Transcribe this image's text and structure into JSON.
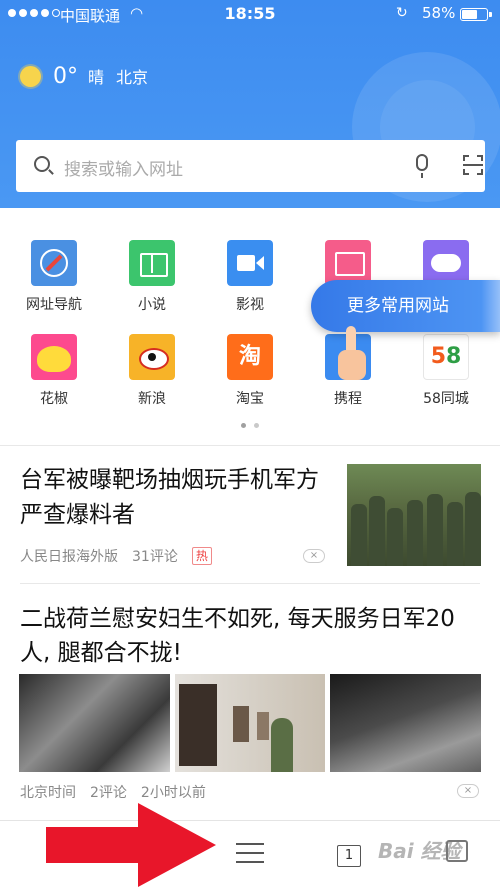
{
  "status_bar": {
    "carrier": "中国联通",
    "time": "18:55",
    "battery": "58%",
    "battery_level": 0.58
  },
  "weather": {
    "temperature": "0°",
    "condition": "晴",
    "city": "北京"
  },
  "search": {
    "placeholder": "搜索或输入网址"
  },
  "quick_links": [
    {
      "label": "网址导航",
      "icon": "compass-icon"
    },
    {
      "label": "小说",
      "icon": "book-icon"
    },
    {
      "label": "影视",
      "icon": "video-camera-icon"
    },
    {
      "label": "",
      "icon": "picture-icon"
    },
    {
      "label": "",
      "icon": "gamepad-icon"
    },
    {
      "label": "花椒",
      "icon": "huajiao-icon"
    },
    {
      "label": "新浪",
      "icon": "sina-weibo-icon"
    },
    {
      "label": "淘宝",
      "icon": "taobao-icon",
      "glyph": "淘"
    },
    {
      "label": "携程",
      "icon": "ctrip-icon"
    },
    {
      "label": "58同城",
      "icon": "58-icon",
      "glyph_a": "5",
      "glyph_b": "8"
    }
  ],
  "tooltip": "更多常用网站",
  "news": [
    {
      "title": "台军被曝靶场抽烟玩手机军方严查爆料者",
      "source": "人民日报海外版",
      "comments": "31评论",
      "badge": "热"
    },
    {
      "title": "二战荷兰慰安妇生不如死, 每天服务日军20人, 腿都合不拢!",
      "source": "北京时间",
      "comments": "2评论",
      "time": "2小时以前"
    }
  ],
  "bottom_bar": {
    "tabs_count": "1"
  },
  "colors": {
    "header_blue": "#3d8cf0",
    "annotation_red": "#e8162a"
  }
}
